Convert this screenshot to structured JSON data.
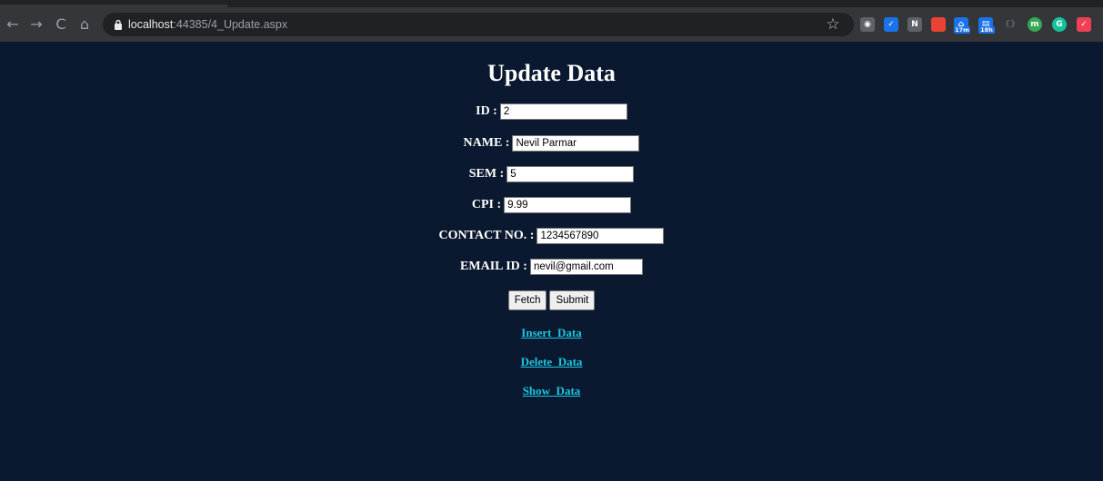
{
  "browser": {
    "url_host": "localhost",
    "url_rest": ":44385/4_Update.aspx",
    "extensions": [
      {
        "icon": "location-pin-icon",
        "color": "#5f6368"
      },
      {
        "icon": "checkbox-icon",
        "color": "#1a73e8"
      },
      {
        "icon": "notion-icon",
        "color": "#5f6368"
      },
      {
        "icon": "bookmark-red-icon",
        "color": "#ea4335"
      },
      {
        "icon": "house-icon",
        "color": "#1a73e8",
        "badge": "17m"
      },
      {
        "icon": "calendar-icon",
        "color": "#1a73e8",
        "badge": "18h"
      },
      {
        "icon": "code-brackets-icon",
        "color": "#3c4043"
      },
      {
        "icon": "m-circle-icon",
        "color": "#34a853"
      },
      {
        "icon": "grammarly-icon",
        "color": "#15c39a"
      },
      {
        "icon": "pocket-icon",
        "color": "#ef4056"
      }
    ]
  },
  "page": {
    "title": "Update Data",
    "fields": [
      {
        "label": "ID :",
        "value": "2"
      },
      {
        "label": "NAME :",
        "value": "Nevil Parmar"
      },
      {
        "label": "SEM :",
        "value": "5"
      },
      {
        "label": "CPI :",
        "value": "9.99"
      },
      {
        "label": "CONTACT NO. :",
        "value": "1234567890"
      },
      {
        "label": "EMAIL ID :",
        "value": "nevil@gmail.com"
      }
    ],
    "buttons": {
      "fetch": "Fetch",
      "submit": "Submit"
    },
    "links": [
      "Insert_Data",
      "Delete_Data",
      "Show_Data"
    ]
  }
}
